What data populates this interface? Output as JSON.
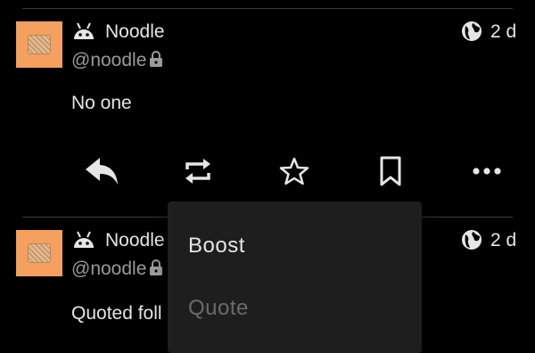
{
  "posts": [
    {
      "display_name": "Noodle",
      "handle": "@noodle",
      "time": "2 d",
      "content": "No one"
    },
    {
      "display_name": "Noodle",
      "handle": "@noodle",
      "time": "2 d",
      "content": "Quoted foll"
    }
  ],
  "actions": [
    "reply-icon",
    "boost-icon",
    "favourite-icon",
    "bookmark-icon",
    "more-icon"
  ],
  "menu": {
    "items": [
      {
        "label": "Boost",
        "enabled": true
      },
      {
        "label": "Quote",
        "enabled": false
      }
    ]
  },
  "colors": {
    "background": "#000000",
    "avatar": "#f5a05e",
    "text": "#e6e6e6",
    "muted": "#9a9a9a",
    "menu_bg": "#1e1e1e"
  }
}
